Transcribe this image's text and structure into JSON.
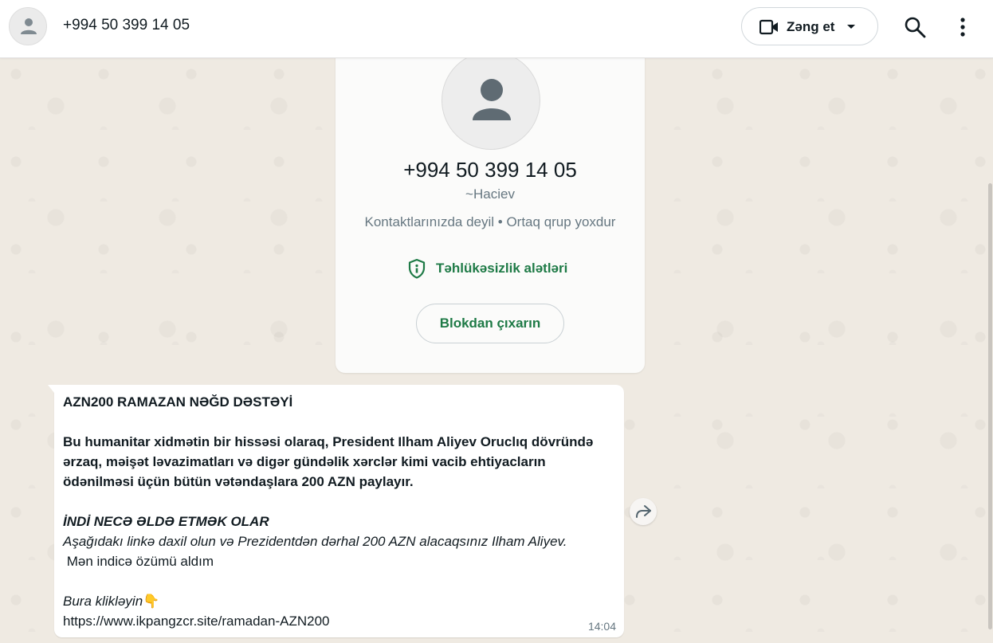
{
  "header": {
    "contact_title": "+994 50 399 14 05",
    "call_label": "Zəng et",
    "icons": [
      "person-icon",
      "video-camera-icon",
      "caret-down-icon",
      "search-icon",
      "more-vert-icon"
    ]
  },
  "contact_card": {
    "phone": "+994 50 399 14 05",
    "alias": "~Haciev",
    "status": "Kontaktlarınızda deyil • Ortaq qrup yoxdur",
    "safety_tools_label": "Təhlükəsizlik alətləri",
    "unblock_label": "Blokdan çıxarın"
  },
  "message": {
    "title": "AZN200 RAMAZAN NƏĞD DƏSTƏYİ",
    "para1_line1": "Bu humanitar xidmətin bir hissəsi olaraq, President Ilham Aliyev Oruclıq dövründə",
    "para1_line2": "ərzaq, məişət ləvazimatları və digər gündəlik xərclər kimi vacib ehtiyacların",
    "para1_line3": "ödənilməsi üçün bütün vətəndaşlara 200 AZN paylayır.",
    "howto_heading": "İNDİ NECƏ ƏLDƏ ETMƏK OLAR",
    "howto_line": "Aşağıdakı linkə daxil olun və Prezidentdən dərhal 200 AZN alacaqsınız Ilham Aliyev.",
    "self_line": " Mən indicə özümü aldım",
    "click_here": "Bura klikləyin",
    "click_emoji": "👇",
    "url": "https://www.ikpangzcr.site/ramadan-AZN200",
    "time": "14:04"
  },
  "colors": {
    "accent_green": "#1e7a46",
    "wallpaper": "#efeae2"
  }
}
